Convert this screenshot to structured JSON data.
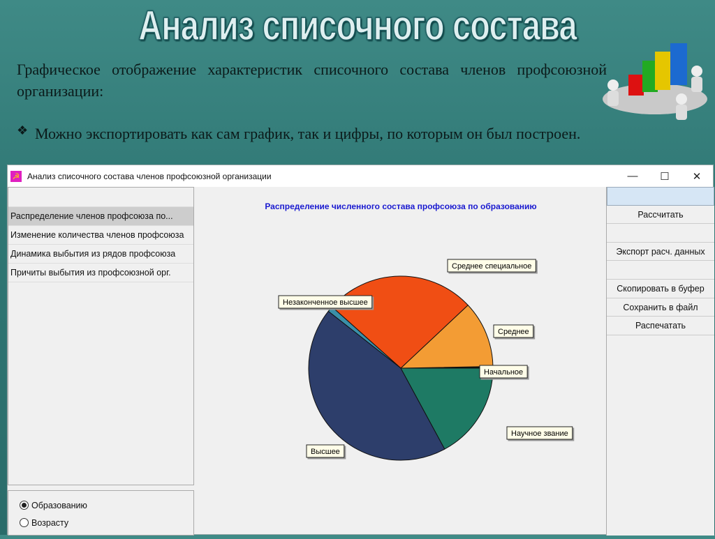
{
  "slide": {
    "title": "Анализ списочного состава",
    "paragraph": "Графическое отображение характеристик списочного состава членов профсоюзной организации:",
    "bullet": "Можно экспортировать как сам график, так и цифры, по которым он был построен.",
    "bullet_icon": "❖"
  },
  "window": {
    "title": "Анализ списочного состава членов профсоюзной организации",
    "controls": {
      "minimize": "—",
      "maximize": "☐",
      "close": "✕"
    }
  },
  "sidebar": {
    "items": [
      {
        "label": "Распределение членов профсоюза по..."
      },
      {
        "label": "Изменение количества членов профсоюза"
      },
      {
        "label": "Динамика выбытия из рядов профсоюза"
      },
      {
        "label": "Причиты выбытия из профсоюзной орг."
      }
    ],
    "radios": [
      {
        "label": "Образованию",
        "checked": true
      },
      {
        "label": "Возрасту",
        "checked": false
      }
    ]
  },
  "buttons": {
    "calculate": "Рассчитать",
    "export": "Экспорт расч. данных",
    "copy": "Скопировать в буфер",
    "save": "Сохранить в файл",
    "print": "Распечатать"
  },
  "chart_data": {
    "type": "pie",
    "title": "Распределение численного состава профсоюза по образованию",
    "slices": [
      {
        "label": "Начальное",
        "value": 0.3,
        "color": "#111111"
      },
      {
        "label": "Среднее",
        "value": 11.7,
        "color": "#f39c34"
      },
      {
        "label": "Среднее специальное",
        "value": 26.4,
        "color": "#f04e14"
      },
      {
        "label": "Незаконченное высшее",
        "value": 1.0,
        "color": "#3a8fa8"
      },
      {
        "label": "Высшее",
        "value": 43.5,
        "color": "#2d3e6b"
      },
      {
        "label": "Научное звание",
        "value": 17.1,
        "color": "#1e7a64"
      }
    ],
    "title_color": "#1a1ad0"
  }
}
